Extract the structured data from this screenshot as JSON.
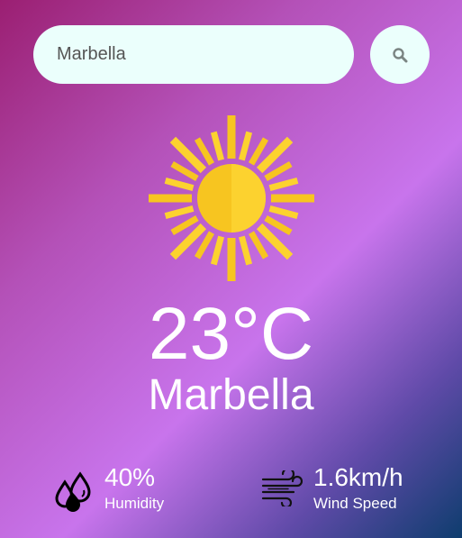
{
  "search": {
    "value": "Marbella",
    "button_icon": "search-icon"
  },
  "weather": {
    "icon": "sun-icon",
    "temperature": "23°C",
    "city": "Marbella"
  },
  "details": {
    "humidity": {
      "icon": "humidity-icon",
      "value": "40%",
      "label": "Humidity"
    },
    "wind": {
      "icon": "wind-icon",
      "value": "1.6km/h",
      "label": "Wind Speed"
    }
  },
  "colors": {
    "gradient_start": "#9b1f72",
    "gradient_mid": "#c874ec",
    "gradient_end": "#0e3d6e",
    "search_bg": "#ebfffc",
    "sun": "#f7c520",
    "text": "#ffffff"
  }
}
